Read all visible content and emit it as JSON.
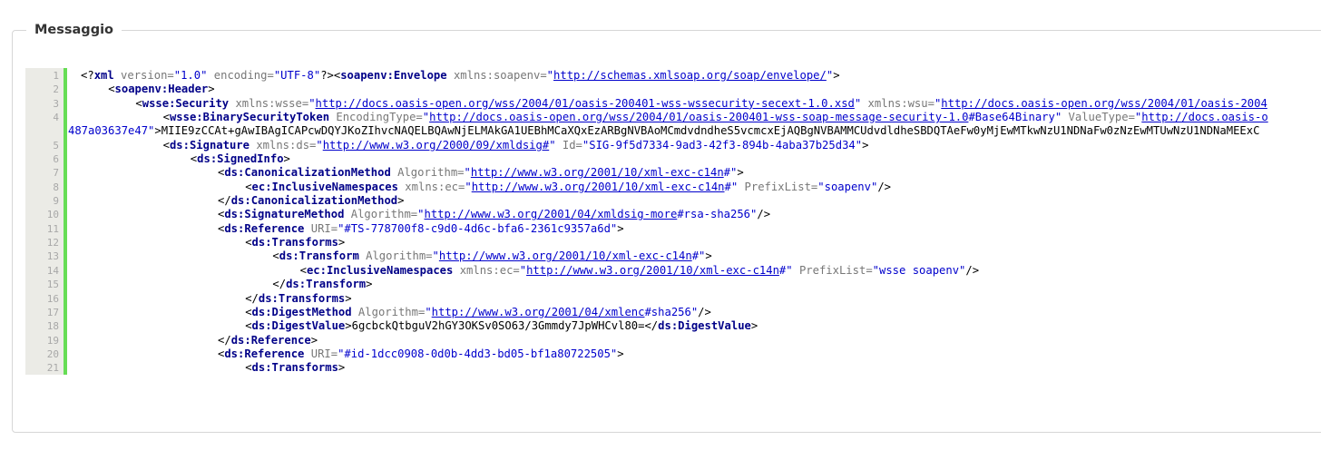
{
  "legend": "Messaggio",
  "lines": [
    {
      "n": "1",
      "indent": 0,
      "s": [
        [
          "p",
          "<?"
        ],
        [
          "tn",
          "xml"
        ],
        [
          "a",
          " version="
        ],
        [
          "v",
          "\"1.0\""
        ],
        [
          "a",
          " encoding="
        ],
        [
          "v",
          "\"UTF-8\""
        ],
        [
          "p",
          "?><"
        ],
        [
          "tn",
          "soapenv:Envelope"
        ],
        [
          "a",
          " xmlns:soapenv="
        ],
        [
          "v",
          "\""
        ],
        [
          "u",
          "http://schemas.xmlsoap.org/soap/envelope/"
        ],
        [
          "v",
          "\""
        ],
        [
          "p",
          ">"
        ]
      ]
    },
    {
      "n": "2",
      "indent": 1,
      "s": [
        [
          "p",
          "<"
        ],
        [
          "tn",
          "soapenv:Header"
        ],
        [
          "p",
          ">"
        ]
      ]
    },
    {
      "n": "3",
      "indent": 2,
      "s": [
        [
          "p",
          "<"
        ],
        [
          "tn",
          "wsse:Security"
        ],
        [
          "a",
          " xmlns:wsse="
        ],
        [
          "v",
          "\""
        ],
        [
          "u",
          "http://docs.oasis-open.org/wss/2004/01/oasis-200401-wss-wssecurity-secext-1.0.xsd"
        ],
        [
          "v",
          "\""
        ],
        [
          "a",
          " xmlns:wsu="
        ],
        [
          "v",
          "\""
        ],
        [
          "u",
          "http://docs.oasis-open.org/wss/2004/01/oasis-2004"
        ]
      ]
    },
    {
      "n": "4",
      "indent": 3,
      "s": [
        [
          "p",
          "<"
        ],
        [
          "tn",
          "wsse:BinarySecurityToken"
        ],
        [
          "a",
          " EncodingType="
        ],
        [
          "v",
          "\""
        ],
        [
          "u",
          "http://docs.oasis-open.org/wss/2004/01/oasis-200401-wss-soap-message-security-1.0"
        ],
        [
          "v",
          "#Base64Binary\""
        ],
        [
          "a",
          " ValueType="
        ],
        [
          "v",
          "\""
        ],
        [
          "u",
          "http://docs.oasis-o"
        ]
      ]
    },
    {
      "n": "",
      "indent": -2,
      "s": [
        [
          "v",
          "487a03637e47\""
        ],
        [
          "p",
          ">MIIE9zCCAt+gAwIBAgICAPcwDQYJKoZIhvcNAQELBQAwNjELMAkGA1UEBhMCaXQxEzARBgNVBAoMCmdvdndheS5vcmcxEjAQBgNVBAMMCUdvdldheSBDQTAeFw0yMjEwMTkwNzU1NDNaFw0zNzEwMTUwNzU1NDNaMEExC"
        ]
      ]
    },
    {
      "n": "5",
      "indent": 3,
      "s": [
        [
          "p",
          "<"
        ],
        [
          "tn",
          "ds:Signature"
        ],
        [
          "a",
          " xmlns:ds="
        ],
        [
          "v",
          "\""
        ],
        [
          "u",
          "http://www.w3.org/2000/09/xmldsig#"
        ],
        [
          "v",
          "\""
        ],
        [
          "a",
          " Id="
        ],
        [
          "v",
          "\"SIG-9f5d7334-9ad3-42f3-894b-4aba37b25d34\""
        ],
        [
          "p",
          ">"
        ]
      ]
    },
    {
      "n": "6",
      "indent": 4,
      "s": [
        [
          "p",
          "<"
        ],
        [
          "tn",
          "ds:SignedInfo"
        ],
        [
          "p",
          ">"
        ]
      ]
    },
    {
      "n": "7",
      "indent": 5,
      "s": [
        [
          "p",
          "<"
        ],
        [
          "tn",
          "ds:CanonicalizationMethod"
        ],
        [
          "a",
          " Algorithm="
        ],
        [
          "v",
          "\""
        ],
        [
          "u",
          "http://www.w3.org/2001/10/xml-exc-c14n"
        ],
        [
          "v",
          "#\""
        ],
        [
          "p",
          ">"
        ]
      ]
    },
    {
      "n": "8",
      "indent": 6,
      "s": [
        [
          "p",
          "<"
        ],
        [
          "tn",
          "ec:InclusiveNamespaces"
        ],
        [
          "a",
          " xmlns:ec="
        ],
        [
          "v",
          "\""
        ],
        [
          "u",
          "http://www.w3.org/2001/10/xml-exc-c14n"
        ],
        [
          "v",
          "#\""
        ],
        [
          "a",
          " PrefixList="
        ],
        [
          "v",
          "\"soapenv\""
        ],
        [
          "p",
          "/>"
        ]
      ]
    },
    {
      "n": "9",
      "indent": 5,
      "s": [
        [
          "p",
          "</"
        ],
        [
          "tn",
          "ds:CanonicalizationMethod"
        ],
        [
          "p",
          ">"
        ]
      ]
    },
    {
      "n": "10",
      "indent": 5,
      "s": [
        [
          "p",
          "<"
        ],
        [
          "tn",
          "ds:SignatureMethod"
        ],
        [
          "a",
          " Algorithm="
        ],
        [
          "v",
          "\""
        ],
        [
          "u",
          "http://www.w3.org/2001/04/xmldsig-more"
        ],
        [
          "v",
          "#rsa-sha256\""
        ],
        [
          "p",
          "/>"
        ]
      ]
    },
    {
      "n": "11",
      "indent": 5,
      "s": [
        [
          "p",
          "<"
        ],
        [
          "tn",
          "ds:Reference"
        ],
        [
          "a",
          " URI="
        ],
        [
          "v",
          "\"#TS-778700f8-c9d0-4d6c-bfa6-2361c9357a6d\""
        ],
        [
          "p",
          ">"
        ]
      ]
    },
    {
      "n": "12",
      "indent": 6,
      "s": [
        [
          "p",
          "<"
        ],
        [
          "tn",
          "ds:Transforms"
        ],
        [
          "p",
          ">"
        ]
      ]
    },
    {
      "n": "13",
      "indent": 7,
      "s": [
        [
          "p",
          "<"
        ],
        [
          "tn",
          "ds:Transform"
        ],
        [
          "a",
          " Algorithm="
        ],
        [
          "v",
          "\""
        ],
        [
          "u",
          "http://www.w3.org/2001/10/xml-exc-c14n"
        ],
        [
          "v",
          "#\""
        ],
        [
          "p",
          ">"
        ]
      ]
    },
    {
      "n": "14",
      "indent": 8,
      "s": [
        [
          "p",
          "<"
        ],
        [
          "tn",
          "ec:InclusiveNamespaces"
        ],
        [
          "a",
          " xmlns:ec="
        ],
        [
          "v",
          "\""
        ],
        [
          "u",
          "http://www.w3.org/2001/10/xml-exc-c14n"
        ],
        [
          "v",
          "#\""
        ],
        [
          "a",
          " PrefixList="
        ],
        [
          "v",
          "\"wsse soapenv\""
        ],
        [
          "p",
          "/>"
        ]
      ]
    },
    {
      "n": "15",
      "indent": 7,
      "s": [
        [
          "p",
          "</"
        ],
        [
          "tn",
          "ds:Transform"
        ],
        [
          "p",
          ">"
        ]
      ]
    },
    {
      "n": "16",
      "indent": 6,
      "s": [
        [
          "p",
          "</"
        ],
        [
          "tn",
          "ds:Transforms"
        ],
        [
          "p",
          ">"
        ]
      ]
    },
    {
      "n": "17",
      "indent": 6,
      "s": [
        [
          "p",
          "<"
        ],
        [
          "tn",
          "ds:DigestMethod"
        ],
        [
          "a",
          " Algorithm="
        ],
        [
          "v",
          "\""
        ],
        [
          "u",
          "http://www.w3.org/2001/04/xmlenc"
        ],
        [
          "v",
          "#sha256\""
        ],
        [
          "p",
          "/>"
        ]
      ]
    },
    {
      "n": "18",
      "indent": 6,
      "s": [
        [
          "p",
          "<"
        ],
        [
          "tn",
          "ds:DigestValue"
        ],
        [
          "p",
          ">6gcbckQtbguV2hGY3OKSv0SO63/3Gmmdy7JpWHCvl80=</"
        ],
        [
          "tn",
          "ds:DigestValue"
        ],
        [
          "p",
          ">"
        ]
      ]
    },
    {
      "n": "19",
      "indent": 5,
      "s": [
        [
          "p",
          "</"
        ],
        [
          "tn",
          "ds:Reference"
        ],
        [
          "p",
          ">"
        ]
      ]
    },
    {
      "n": "20",
      "indent": 5,
      "s": [
        [
          "p",
          "<"
        ],
        [
          "tn",
          "ds:Reference"
        ],
        [
          "a",
          " URI="
        ],
        [
          "v",
          "\"#id-1dcc0908-0d0b-4dd3-bd05-bf1a80722505\""
        ],
        [
          "p",
          ">"
        ]
      ]
    },
    {
      "n": "21",
      "indent": 6,
      "s": [
        [
          "p",
          "<"
        ],
        [
          "tn",
          "ds:Transforms"
        ],
        [
          "p",
          ">"
        ]
      ]
    }
  ]
}
